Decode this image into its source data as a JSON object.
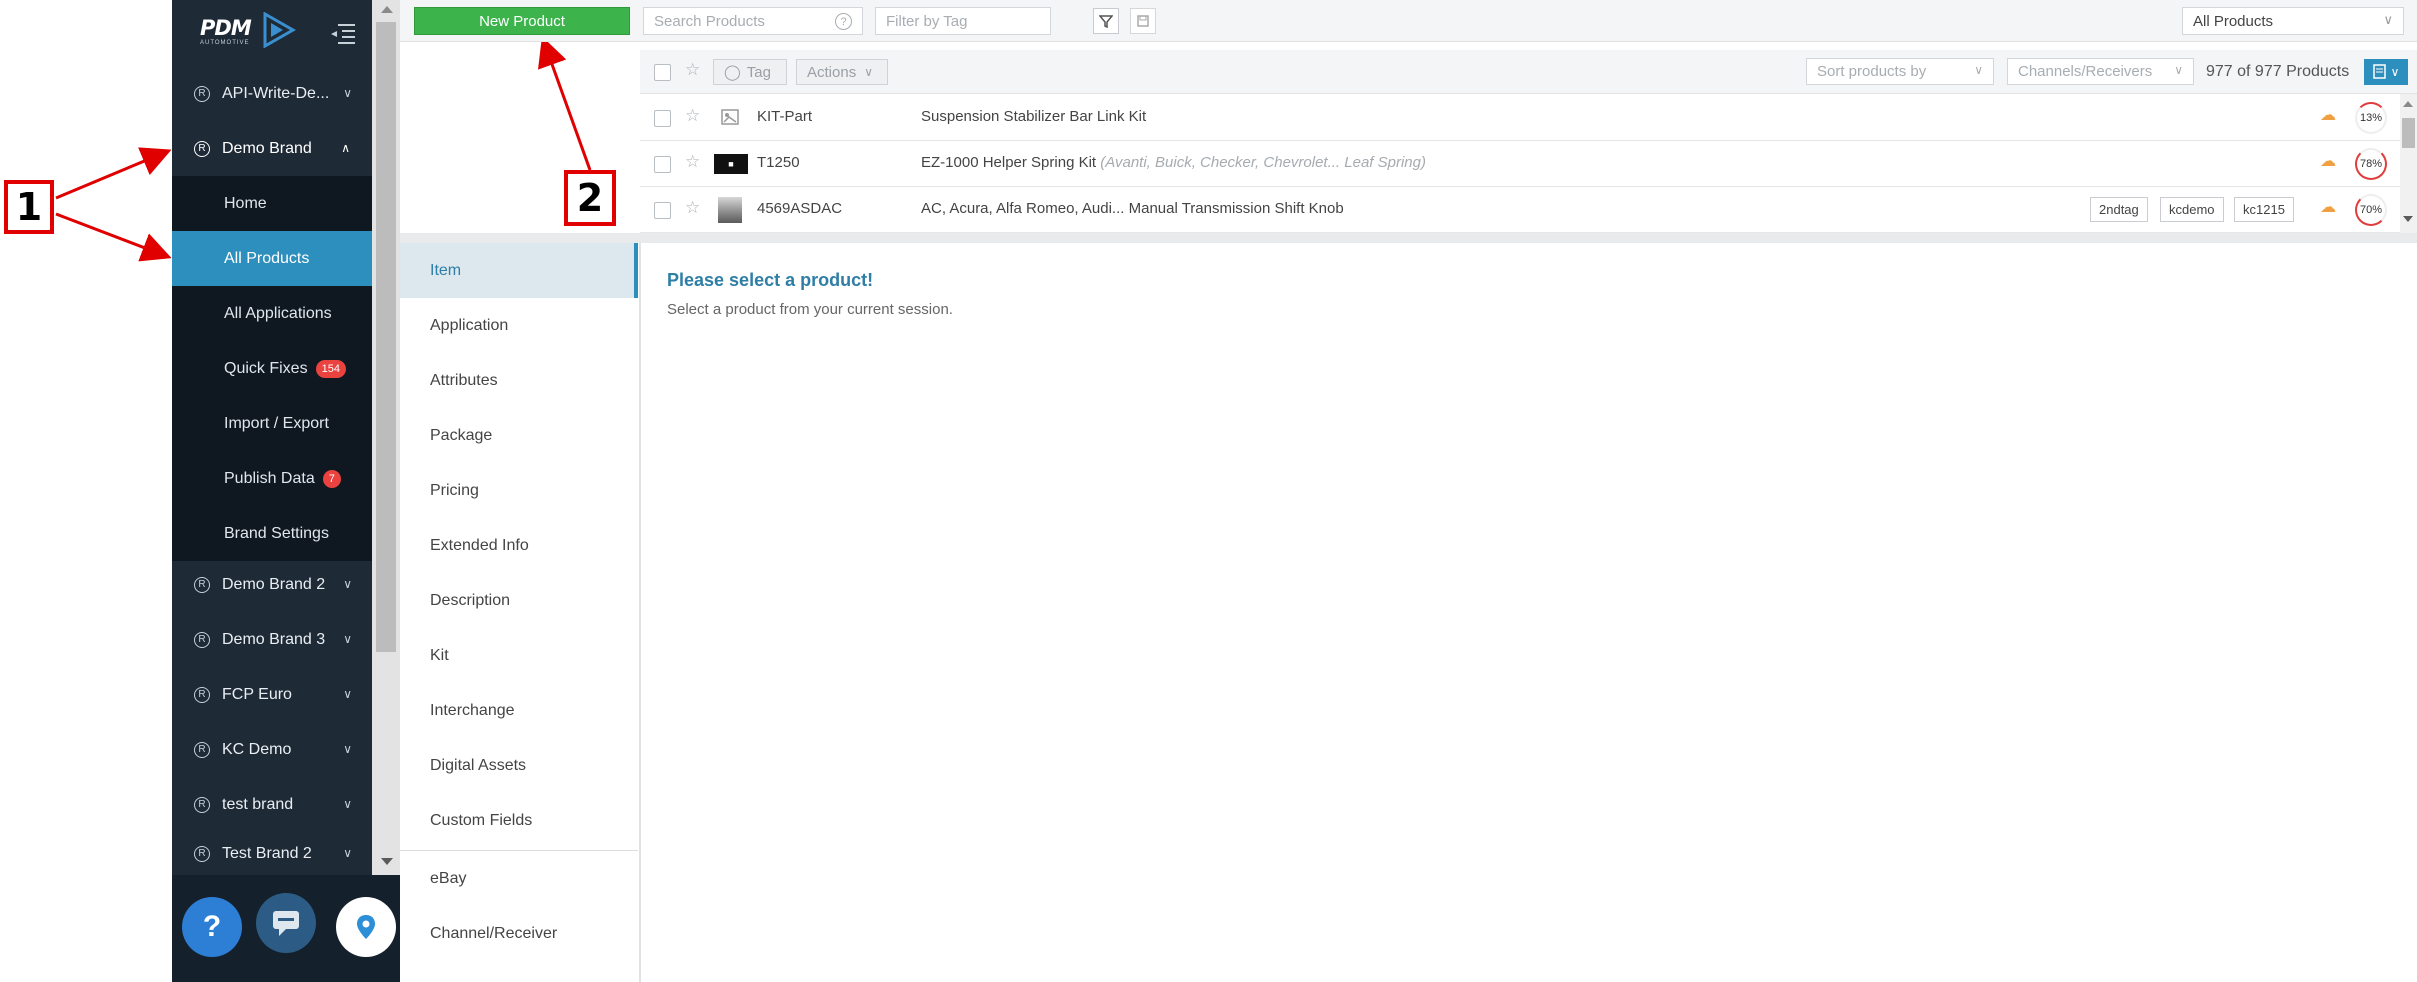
{
  "annotations": {
    "callout_1": "1",
    "callout_2": "2"
  },
  "sidebar": {
    "logo_text": "PDM",
    "logo_subtext": "AUTOMOTIVE",
    "brands_top": [
      {
        "label": "API-Write-De..."
      }
    ],
    "active_brand": {
      "label": "Demo Brand",
      "items": [
        {
          "label": "Home"
        },
        {
          "label": "All Products"
        },
        {
          "label": "All Applications"
        },
        {
          "label": "Quick Fixes",
          "badge": "154"
        },
        {
          "label": "Import / Export"
        },
        {
          "label": "Publish Data",
          "badge": "7"
        },
        {
          "label": "Brand Settings"
        }
      ]
    },
    "brands_bottom": [
      {
        "label": "Demo Brand 2"
      },
      {
        "label": "Demo Brand 3"
      },
      {
        "label": "FCP Euro"
      },
      {
        "label": "KC Demo"
      },
      {
        "label": "test brand"
      },
      {
        "label": "Test Brand 2"
      }
    ],
    "reg_symbol": "R",
    "help_symbol": "?"
  },
  "toolbar": {
    "new_product_label": "New Product",
    "search_placeholder": "Search Products",
    "filter_placeholder": "Filter by Tag",
    "all_products_select": "All Products"
  },
  "list": {
    "tag_label": "Tag",
    "actions_label": "Actions",
    "sort_label": "Sort products by",
    "channels_label": "Channels/Receivers",
    "count_label": "977 of 977 Products",
    "rows": [
      {
        "part": "KIT-Part",
        "desc": "Suspension Stabilizer Bar Link Kit",
        "desc_extra": "",
        "tags": [],
        "percent": "13%",
        "pct_value": 13
      },
      {
        "part": "T1250",
        "desc": "EZ-1000 Helper Spring Kit",
        "desc_extra": "(Avanti, Buick, Checker, Chevrolet... Leaf Spring)",
        "tags": [],
        "percent": "78%",
        "pct_value": 78
      },
      {
        "part": "4569ASDAC",
        "desc": "AC, Acura, Alfa Romeo, Audi... Manual Transmission Shift Knob",
        "desc_extra": "",
        "tags": [
          "2ndtag",
          "kcdemo",
          "kc1215"
        ],
        "percent": "70%",
        "pct_value": 70
      }
    ]
  },
  "detail_nav": {
    "items": [
      {
        "label": "Item"
      },
      {
        "label": "Application"
      },
      {
        "label": "Attributes"
      },
      {
        "label": "Package"
      },
      {
        "label": "Pricing"
      },
      {
        "label": "Extended Info"
      },
      {
        "label": "Description"
      },
      {
        "label": "Kit"
      },
      {
        "label": "Interchange"
      },
      {
        "label": "Digital Assets"
      },
      {
        "label": "Custom Fields"
      }
    ],
    "extra_items": [
      {
        "label": "eBay"
      },
      {
        "label": "Channel/Receiver"
      }
    ]
  },
  "detail": {
    "title": "Please select a product!",
    "subtitle": "Select a product from your current session."
  },
  "colors": {
    "sidebar_bg": "#1e2a36",
    "active_blue": "#2d8fbd",
    "new_product_green": "#3cb44b",
    "badge_red": "#e9423f",
    "annotation_red": "#e00000"
  }
}
